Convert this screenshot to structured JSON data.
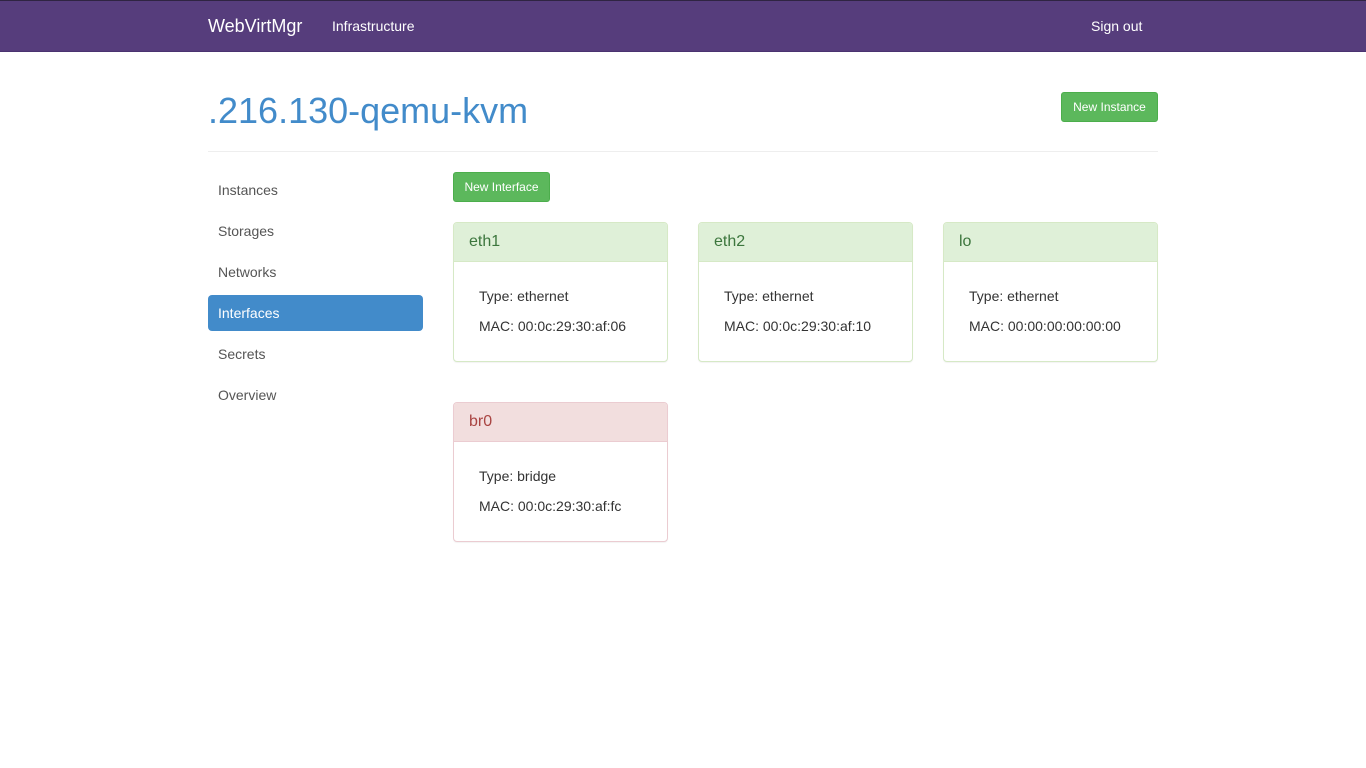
{
  "navbar": {
    "brand": "WebVirtMgr",
    "infrastructure": "Infrastructure",
    "sign_out": "Sign out",
    "bg_color": "#563d7c"
  },
  "page": {
    "title": ".216.130-qemu-kvm",
    "new_instance": "New Instance",
    "new_interface": "New Interface"
  },
  "sidebar": {
    "items": [
      {
        "label": "Instances",
        "active": false
      },
      {
        "label": "Storages",
        "active": false
      },
      {
        "label": "Networks",
        "active": false
      },
      {
        "label": "Interfaces",
        "active": true
      },
      {
        "label": "Secrets",
        "active": false
      },
      {
        "label": "Overview",
        "active": false
      }
    ]
  },
  "interfaces": [
    {
      "name": "eth1",
      "type_label": "Type:",
      "type": "ethernet",
      "mac_label": "MAC:",
      "mac": "00:0c:29:30:af:06",
      "status": "active"
    },
    {
      "name": "eth2",
      "type_label": "Type:",
      "type": "ethernet",
      "mac_label": "MAC:",
      "mac": "00:0c:29:30:af:10",
      "status": "active"
    },
    {
      "name": "lo",
      "type_label": "Type:",
      "type": "ethernet",
      "mac_label": "MAC:",
      "mac": "00:00:00:00:00:00",
      "status": "active"
    },
    {
      "name": "br0",
      "type_label": "Type:",
      "type": "bridge",
      "mac_label": "MAC:",
      "mac": "00:0c:29:30:af:fc",
      "status": "inactive"
    }
  ],
  "colors": {
    "accent": "#428bca",
    "success": "#5cb85c",
    "active_panel": "#dff0d8",
    "inactive_panel": "#f2dede"
  }
}
